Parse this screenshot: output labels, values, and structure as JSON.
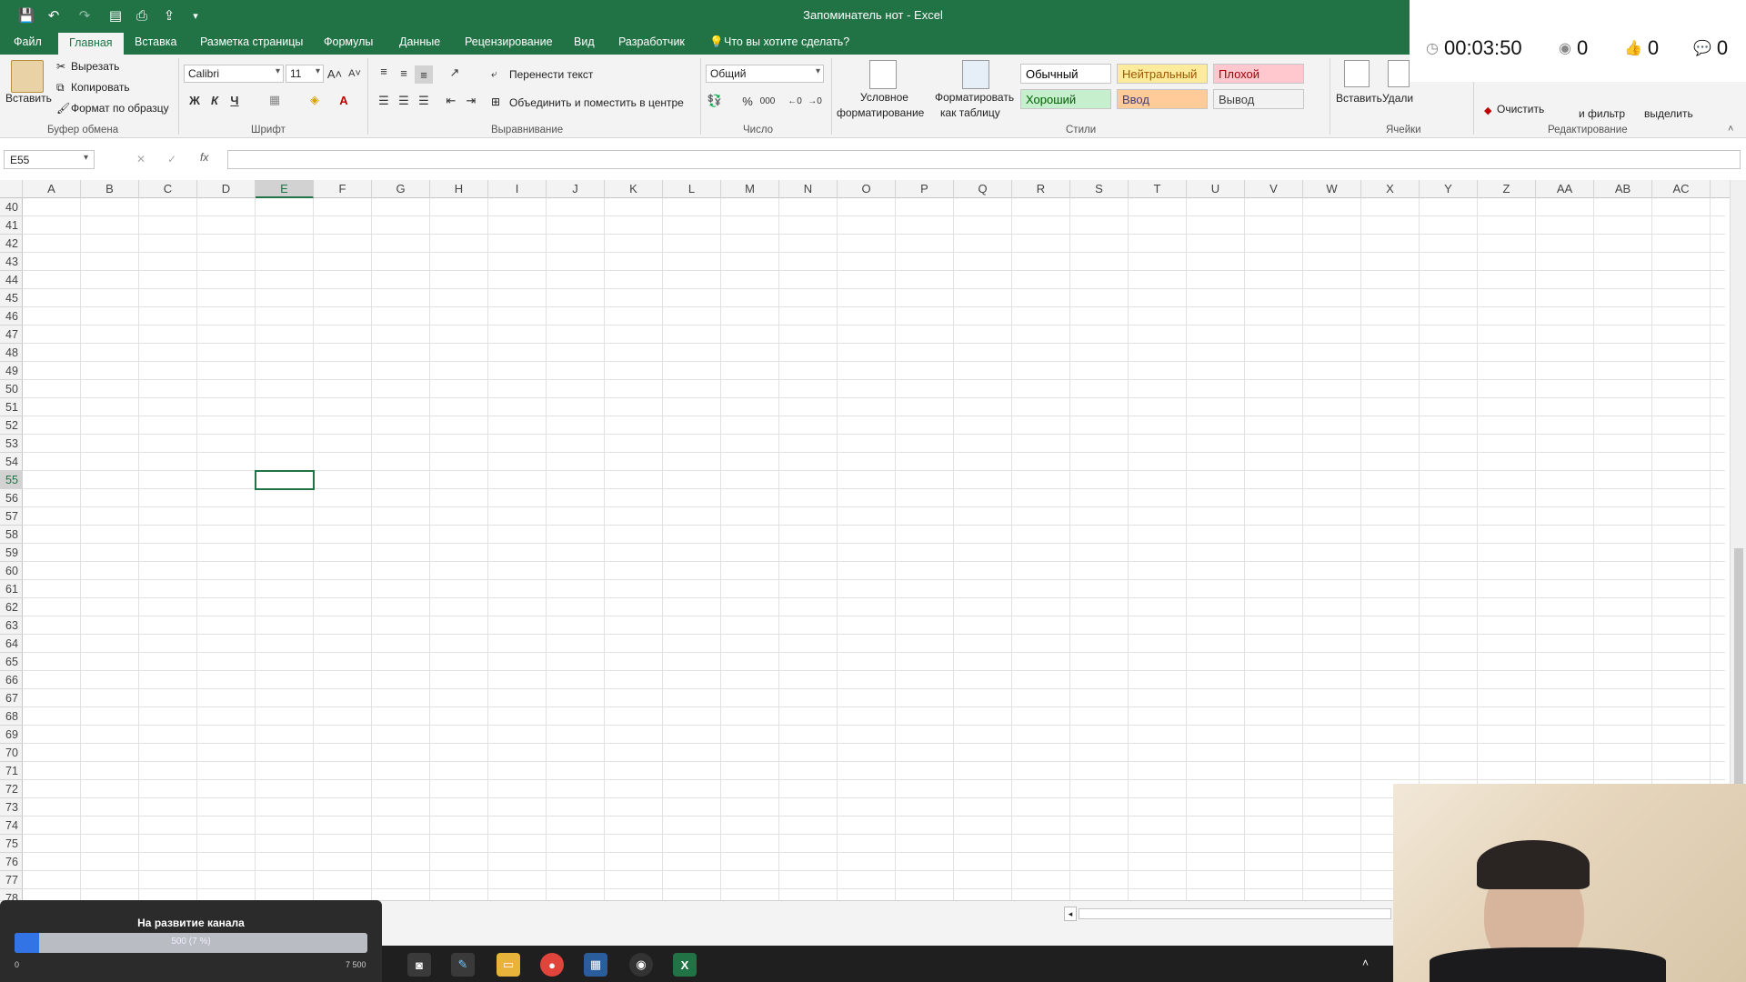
{
  "window": {
    "title": "Запоминатель нот - Excel"
  },
  "quick_access": {
    "icons": [
      "save-icon",
      "undo-icon",
      "redo-icon",
      "print-preview-icon",
      "print-icon",
      "export-icon",
      "customize-icon"
    ]
  },
  "ribbon_tabs": [
    "Файл",
    "Главная",
    "Вставка",
    "Разметка страницы",
    "Формулы",
    "Данные",
    "Рецензирование",
    "Вид",
    "Разработчик"
  ],
  "tell_me": "Что вы хотите сделать?",
  "clipboard": {
    "paste": "Вставить",
    "cut": "Вырезать",
    "copy": "Копировать",
    "format_painter": "Формат по образцу",
    "group": "Буфер обмена"
  },
  "font": {
    "name": "Calibri",
    "size": "11",
    "bold": "Ж",
    "italic": "К",
    "underline": "Ч",
    "group": "Шрифт"
  },
  "alignment": {
    "wrap": "Перенести текст",
    "merge": "Объединить и поместить в центре",
    "group": "Выравнивание"
  },
  "number": {
    "format": "Общий",
    "percent": "%",
    "thousands": "000",
    "group": "Число"
  },
  "styles": {
    "conditional_1": "Условное",
    "conditional_2": "форматирование",
    "format_table_1": "Форматировать",
    "format_table_2": "как таблицу",
    "group": "Стили",
    "cells": [
      {
        "label": "Обычный",
        "bg": "#ffffff",
        "fg": "#000000"
      },
      {
        "label": "Нейтральный",
        "bg": "#ffeb9c",
        "fg": "#9c5700"
      },
      {
        "label": "Плохой",
        "bg": "#ffc7ce",
        "fg": "#9c0006"
      },
      {
        "label": "Хороший",
        "bg": "#c6efce",
        "fg": "#006100"
      },
      {
        "label": "Ввод",
        "bg": "#ffcc99",
        "fg": "#3f3f76"
      },
      {
        "label": "Вывод",
        "bg": "#f2f2f2",
        "fg": "#3f3f3f"
      }
    ]
  },
  "cells_group": {
    "insert": "Вставить",
    "delete": "Удали",
    "group": "Ячейки"
  },
  "editing": {
    "clear": "Очистить",
    "sort": "и фильтр",
    "find": "выделить",
    "group": "Редактирование"
  },
  "formula_bar": {
    "name_box": "E55",
    "fx": "fx",
    "value": ""
  },
  "columns": [
    "A",
    "B",
    "C",
    "D",
    "E",
    "F",
    "G",
    "H",
    "I",
    "J",
    "K",
    "L",
    "M",
    "N",
    "O",
    "P",
    "Q",
    "R",
    "S",
    "T",
    "U",
    "V",
    "W",
    "X",
    "Y",
    "Z",
    "AA",
    "AB",
    "AC"
  ],
  "rows": [
    "40",
    "41",
    "42",
    "43",
    "44",
    "45",
    "46",
    "47",
    "48",
    "49",
    "50",
    "51",
    "52",
    "53",
    "54",
    "55",
    "56",
    "57",
    "58",
    "59",
    "60",
    "61",
    "62",
    "63",
    "64",
    "65",
    "66",
    "67",
    "68",
    "69",
    "70",
    "71",
    "72",
    "73",
    "74",
    "75",
    "76",
    "77",
    "78"
  ],
  "selected": {
    "column": "E",
    "row": "55"
  },
  "stream_overlay": {
    "timer": "00:03:50",
    "viewers": "0",
    "likes": "0",
    "comments": "0"
  },
  "donation": {
    "title": "На развитие канала",
    "progress_label": "500 (7 %)",
    "progress_fraction": 0.07,
    "min": "0",
    "max": "7 500"
  },
  "accent": "#217346"
}
